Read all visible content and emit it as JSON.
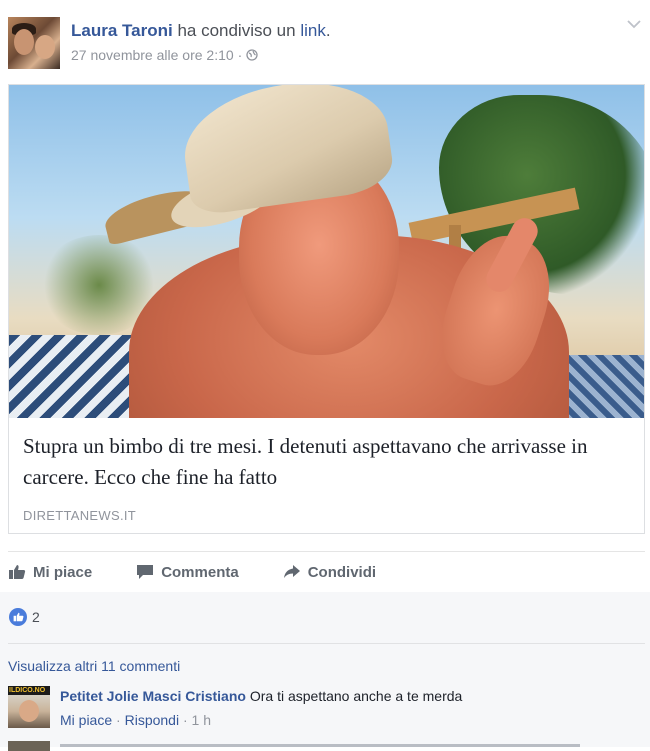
{
  "post": {
    "author": "Laura Taroni",
    "action_verb": "ha condiviso un",
    "action_object": "link",
    "action_end": ".",
    "timestamp": "27 novembre alle ore 2:10",
    "dot": "·",
    "privacy_icon": "globe-icon",
    "menu_icon": "chevron-down-icon"
  },
  "preview": {
    "image": "photo-man-with-cap-at-beach",
    "title": "Stupra un bimbo di tre mesi. I detenuti aspettavano che arrivasse in carcere. Ecco che fine ha fatto",
    "domain": "DIRETTANEWS.IT"
  },
  "actions": {
    "like": "Mi piace",
    "comment": "Commenta",
    "share": "Condividi"
  },
  "reactions": {
    "count": "2",
    "icon": "like-icon"
  },
  "comments": {
    "more_label": "Visualizza altri 11 commenti",
    "items": [
      {
        "author": "Petitet Jolie Masci Cristiano",
        "text": "Ora ti aspettano anche a te merda",
        "avatar_label": "ILDICO.NO",
        "like": "Mi piace",
        "reply": "Rispondi",
        "sep": "·",
        "time": "1 h"
      }
    ]
  },
  "colors": {
    "link_blue": "#365899",
    "meta_gray": "#90949c",
    "like_blue": "#4a7cdb",
    "footer_bg": "#f6f7f9"
  }
}
